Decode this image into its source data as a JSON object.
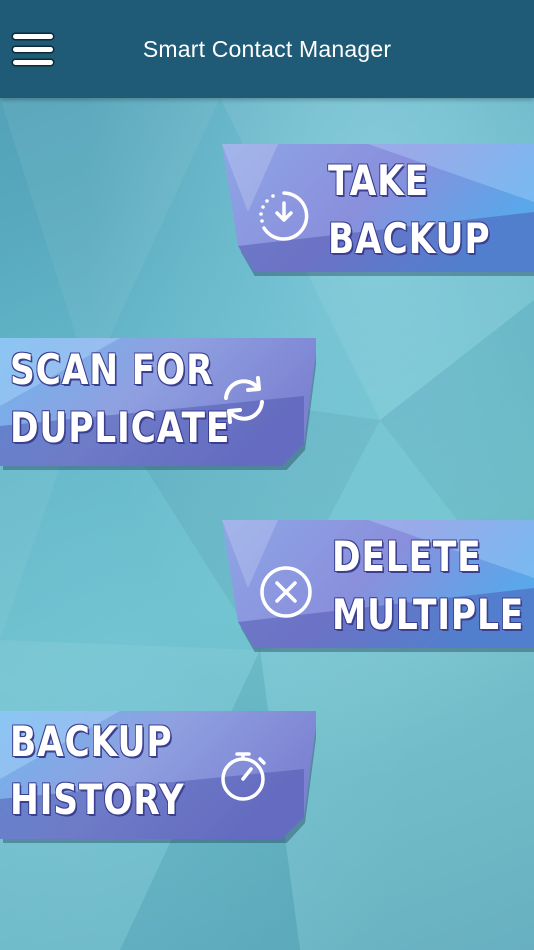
{
  "header": {
    "title": "Smart Contact Manager"
  },
  "actions": {
    "take_backup": {
      "line1": "TAKE",
      "line2": "BACKUP",
      "icon": "backup-clock-icon"
    },
    "scan_duplicate": {
      "line1": "SCAN FOR",
      "line2": "DUPLICATE",
      "icon": "sync-icon"
    },
    "delete_multiple": {
      "line1": "DELETE",
      "line2": "MULTIPLE",
      "icon": "delete-circle-x-icon"
    },
    "backup_history": {
      "line1": "BACKUP",
      "line2": "HISTORY",
      "icon": "stopwatch-icon"
    }
  },
  "colors": {
    "header_bg": "#1f5b76",
    "button_light": "#9fc2f0",
    "button_mid": "#7e8fda",
    "button_dark": "#5b62b8",
    "text_outline": "#3b3f8f"
  }
}
